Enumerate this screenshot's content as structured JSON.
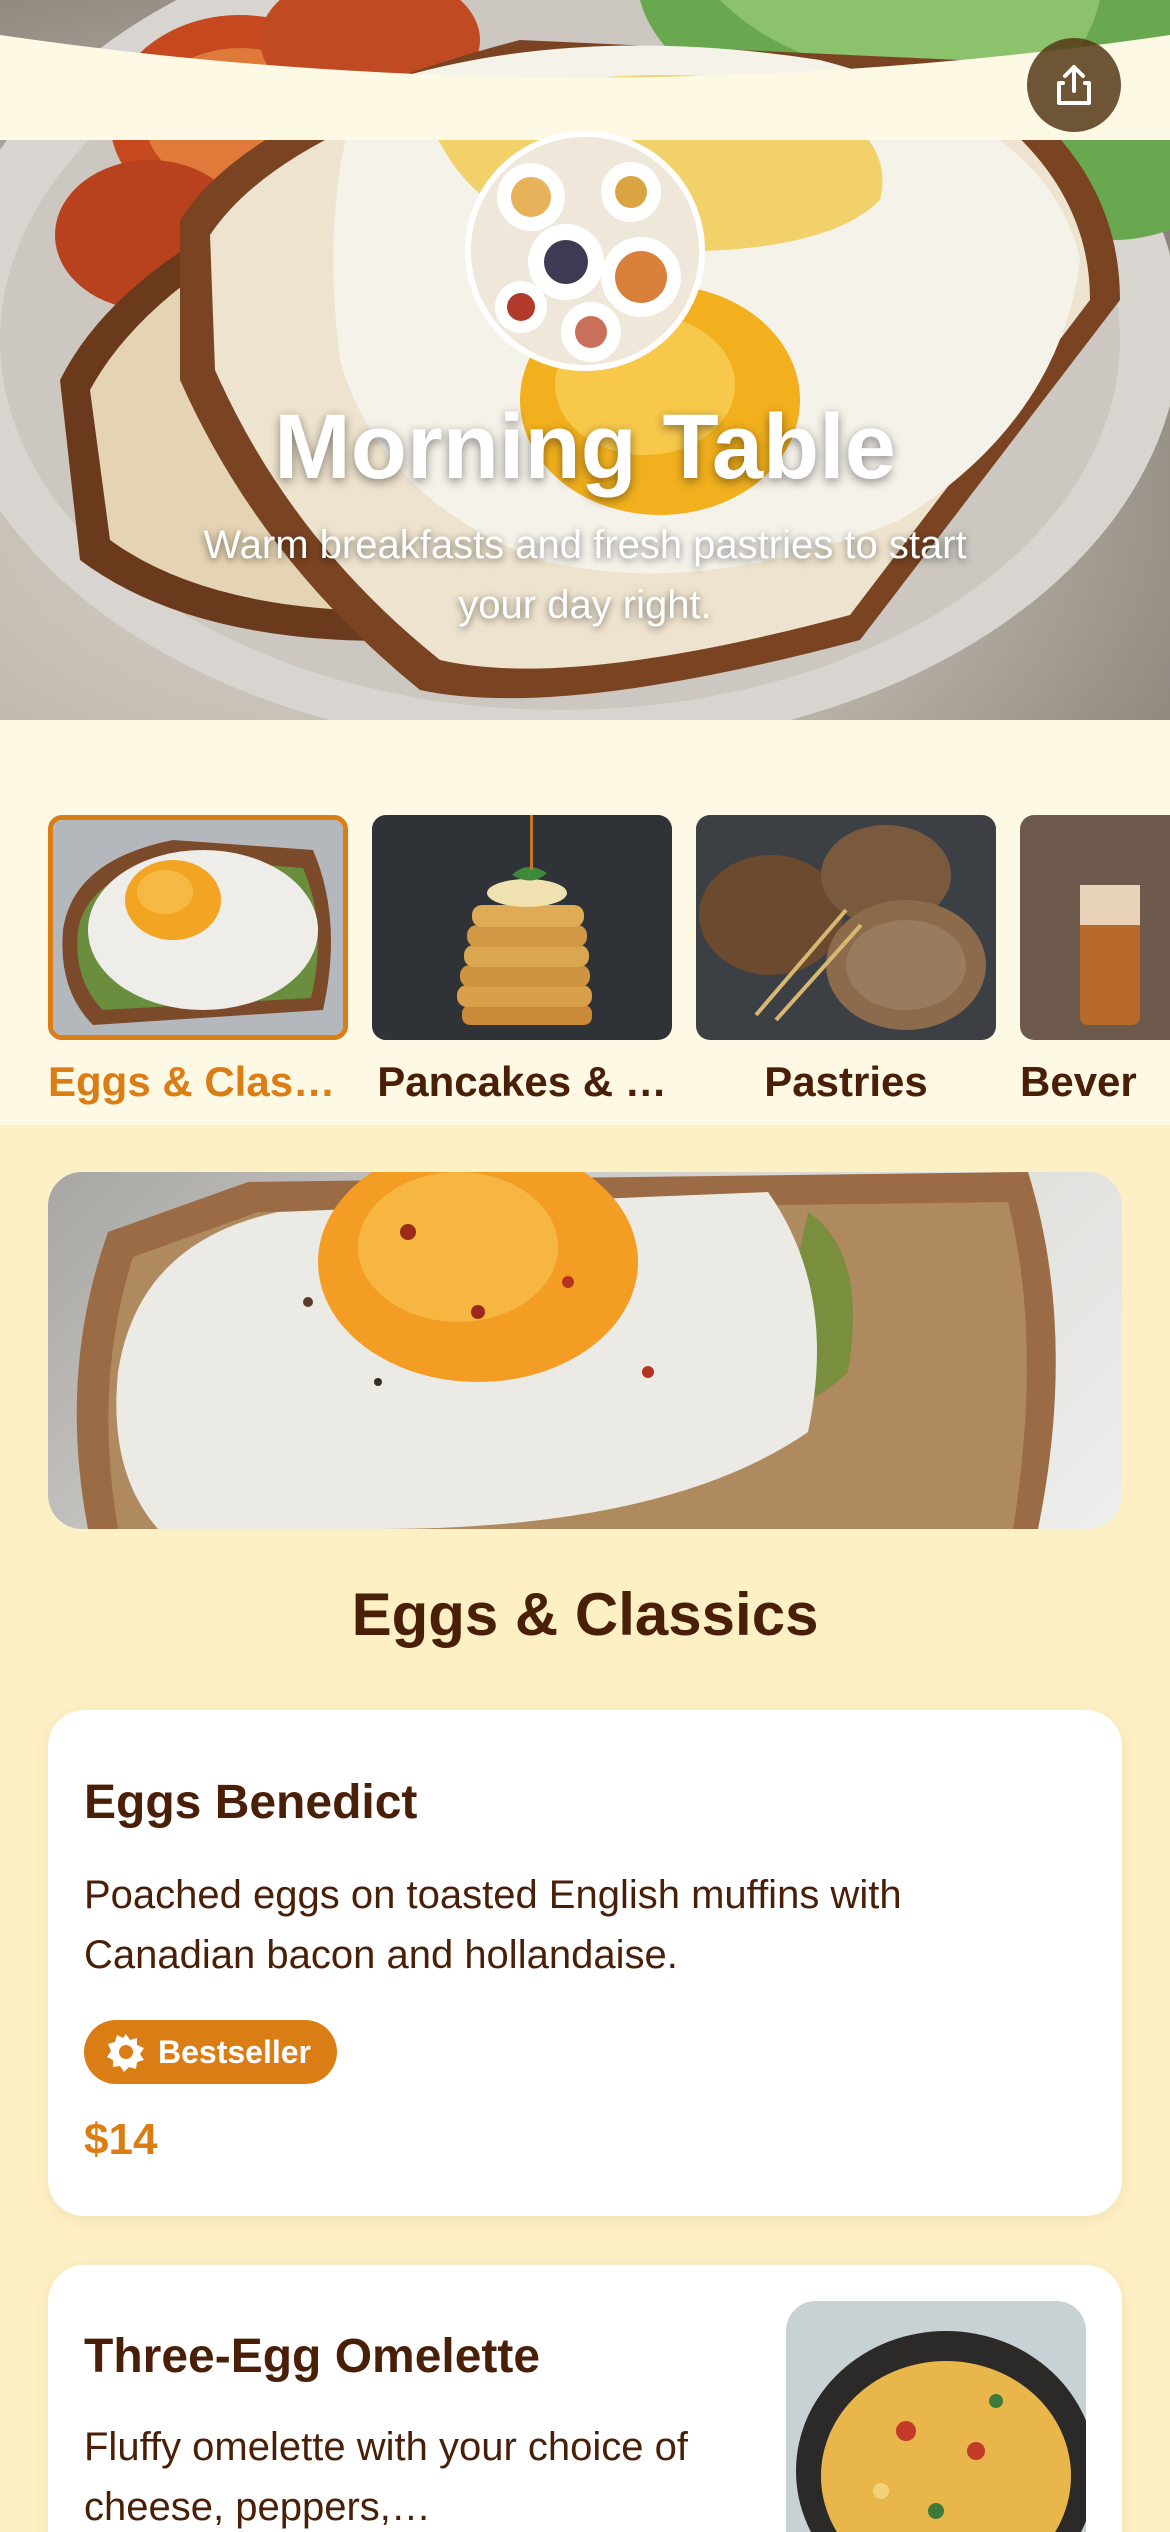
{
  "header": {
    "title": "Morning Table",
    "subtitle": "Warm breakfasts and fresh pastries to start your day right.",
    "share_icon": "share-icon"
  },
  "categories": [
    {
      "label": "Eggs & Clas…",
      "active": true
    },
    {
      "label": "Pancakes & …",
      "active": false
    },
    {
      "label": "Pastries",
      "active": false
    },
    {
      "label": "Bever",
      "active": false
    }
  ],
  "section": {
    "title": "Eggs & Classics"
  },
  "menu_items": [
    {
      "name": "Eggs Benedict",
      "description": "Poached eggs on toasted English muffins with Canadian bacon and hollandaise.",
      "badge": "Bestseller",
      "badge_icon": "star-badge-icon",
      "price": "$14"
    },
    {
      "name": "Three-Egg Omelette",
      "description": "Fluffy omelette with your choice of cheese, peppers,…"
    }
  ],
  "colors": {
    "accent": "#d97d14",
    "text_dark": "#4a1f08",
    "background": "#fdf0c4",
    "card": "#ffffff"
  }
}
